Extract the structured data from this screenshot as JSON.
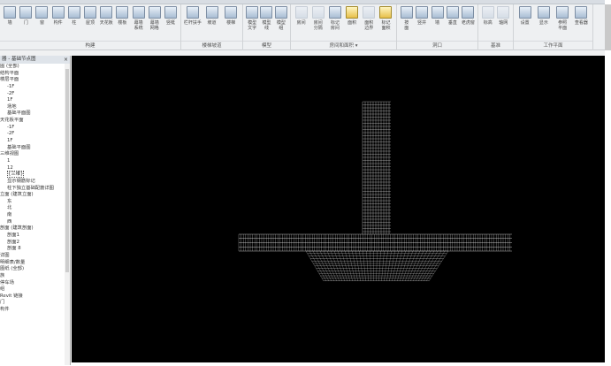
{
  "ribbon": {
    "groups": [
      {
        "label": "构建",
        "tools": [
          "墙",
          "门",
          "窗",
          "构件",
          "柱",
          "屋顶",
          "天花板",
          "楼板",
          "幕墙\n系统",
          "幕墙\n网格",
          "竖梃"
        ]
      },
      {
        "label": "楼梯坡道",
        "tools": [
          "栏杆扶手",
          "坡道",
          "楼梯"
        ]
      },
      {
        "label": "模型",
        "tools": [
          "模型\n文字",
          "模型\n线",
          "模型\n组"
        ]
      },
      {
        "label": "房间和面积 ▾",
        "tools": [
          "房间",
          "房间\n分隔",
          "标记\n房间",
          "面积",
          "面积\n边界",
          "标记\n面积"
        ]
      },
      {
        "label": "洞口",
        "tools": [
          "按\n面",
          "竖井",
          "墙",
          "垂直",
          "老虎窗"
        ]
      },
      {
        "label": "基准",
        "tools": [
          "标高",
          "轴网"
        ]
      },
      {
        "label": "工作平面",
        "tools": [
          "设置",
          "显示",
          "参照\n平面",
          "查看器"
        ]
      }
    ]
  },
  "browser": {
    "title": "器 - 基础节点图",
    "close": "×",
    "nodes": [
      {
        "t": "图 (全部)",
        "c": 0
      },
      {
        "t": "结构平面",
        "c": 0
      },
      {
        "t": "楼层平面",
        "c": 0
      },
      {
        "t": "-1F",
        "c": 1
      },
      {
        "t": "-2F",
        "c": 1
      },
      {
        "t": "1F",
        "c": 1
      },
      {
        "t": "场地",
        "c": 1
      },
      {
        "t": "基础平面图",
        "c": 1
      },
      {
        "t": "天花板平面",
        "c": 0
      },
      {
        "t": "-1F",
        "c": 1
      },
      {
        "t": "-2F",
        "c": 1
      },
      {
        "t": "1F",
        "c": 1
      },
      {
        "t": "基础平面图",
        "c": 1
      },
      {
        "t": "三维视图",
        "c": 0
      },
      {
        "t": "1",
        "c": 1
      },
      {
        "t": "12",
        "c": 1
      },
      {
        "t": "{三维}",
        "c": 1,
        "sel": true
      },
      {
        "t": "显示钢筋标记",
        "c": 1
      },
      {
        "t": "柱下独立基础配筋详图",
        "c": 1
      },
      {
        "t": "立面 (建筑立面)",
        "c": 0
      },
      {
        "t": "东",
        "c": 1
      },
      {
        "t": "北",
        "c": 1
      },
      {
        "t": "南",
        "c": 1
      },
      {
        "t": "西",
        "c": 1
      },
      {
        "t": "剖面 (建筑剖面)",
        "c": 0
      },
      {
        "t": "剖面1",
        "c": 1
      },
      {
        "t": "剖面2",
        "c": 1
      },
      {
        "t": "剖面 8",
        "c": 1
      },
      {
        "t": "详图",
        "c": 0
      },
      {
        "t": "明细表/数量",
        "c": 0
      },
      {
        "t": "图纸 (全部)",
        "c": 0
      },
      {
        "t": "族",
        "c": 0
      },
      {
        "t": "停车场",
        "c": 0
      },
      {
        "t": "组",
        "c": 0
      },
      {
        "t": "Revit 链接",
        "c": 0
      },
      {
        "t": "门",
        "c": 0
      },
      {
        "t": "构件",
        "c": 0
      }
    ]
  },
  "canvas": {
    "background": "#000000",
    "wire_color": "#e8e8e8"
  }
}
